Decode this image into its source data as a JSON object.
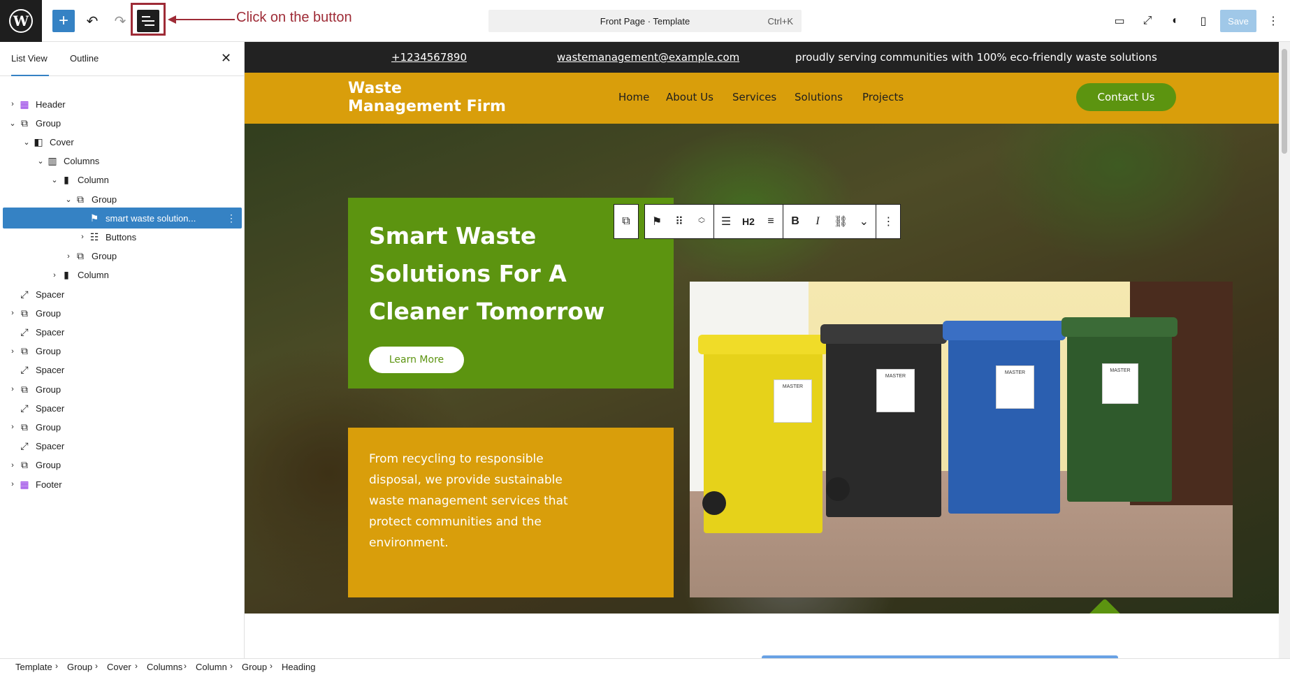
{
  "toolbar": {
    "add_label": "+",
    "undo_label": "↶",
    "redo_label": "↷",
    "command_bar_text": "Front Page · Template",
    "command_bar_shortcut": "Ctrl+K",
    "save_label": "Save",
    "annotation_text": "Click on the button"
  },
  "sidebar": {
    "tab_list_view": "List View",
    "tab_outline": "Outline",
    "close_label": "✕",
    "items": [
      {
        "label": "Header"
      },
      {
        "label": "Group"
      },
      {
        "label": "Cover"
      },
      {
        "label": "Columns"
      },
      {
        "label": "Column"
      },
      {
        "label": "Group"
      },
      {
        "label": "smart waste solution..."
      },
      {
        "label": "Buttons"
      },
      {
        "label": "Group"
      },
      {
        "label": "Column"
      },
      {
        "label": "Spacer"
      },
      {
        "label": "Group"
      },
      {
        "label": "Spacer"
      },
      {
        "label": "Group"
      },
      {
        "label": "Spacer"
      },
      {
        "label": "Group"
      },
      {
        "label": "Spacer"
      },
      {
        "label": "Group"
      },
      {
        "label": "Spacer"
      },
      {
        "label": "Group"
      },
      {
        "label": "Footer"
      }
    ]
  },
  "site": {
    "phone": "+1234567890",
    "email": "wastemanagement@example.com",
    "tagline": "proudly serving communities with 100% eco-friendly waste solutions",
    "title_line1": "Waste",
    "title_line2": "Management Firm",
    "nav": [
      "Home",
      "About Us",
      "Services",
      "Solutions",
      "Projects"
    ],
    "contact_label": "Contact Us",
    "hero_heading": "Smart Waste Solutions For A Cleaner Tomorrow",
    "learn_more": "Learn More",
    "hero_text": "From recycling to responsible disposal, we provide sustainable waste management services that protect communities and the environment."
  },
  "block_toolbar": {
    "heading_level": "H2"
  },
  "breadcrumb": [
    "Template",
    "Group",
    "Cover",
    "Columns",
    "Column",
    "Group",
    "Heading"
  ],
  "colors": {
    "accent": "#3582c4",
    "green": "#5c9410",
    "yellow": "#d99e0b",
    "annotation": "#9e2b36"
  }
}
